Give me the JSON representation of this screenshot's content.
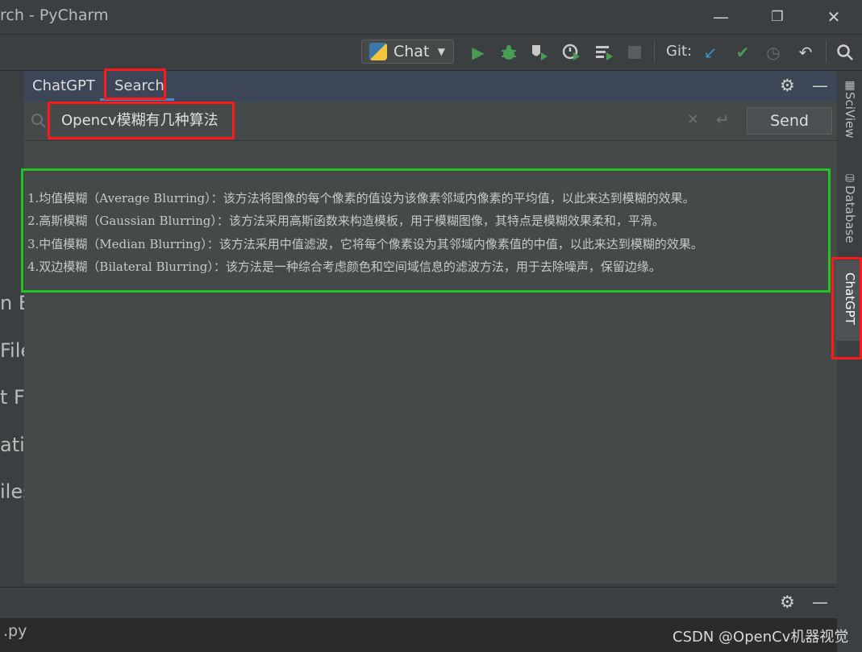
{
  "window": {
    "title": "rch - PyCharm"
  },
  "toolbar": {
    "run_config": "Chat",
    "git_label": "Git:"
  },
  "left_panel": {
    "fragments": [
      "n Ev",
      "File",
      "t Fi",
      "atio",
      "iles"
    ]
  },
  "tool_window": {
    "tabs": [
      "ChatGPT",
      "Search"
    ],
    "active_tab": "Search",
    "search_value": "Opencv模糊有几种算法",
    "send_label": "Send",
    "output_lines": [
      "1.均值模糊（Average Blurring）：该方法将图像的每个像素的值设为该像素邻域内像素的平均值，以此来达到模糊的效果。",
      "2.高斯模糊（Gaussian Blurring）：该方法采用高斯函数来构造模板，用于模糊图像，其特点是模糊效果柔和，平滑。",
      "3.中值模糊（Median Blurring）：该方法采用中值滤波，它将每个像素设为其邻域内像素值的中值，以此来达到模糊的效果。",
      "4.双边模糊（Bilateral Blurring）：该方法是一种综合考虑颜色和空间域信息的滤波方法，用于去除噪声，保留边缘。"
    ]
  },
  "right_strip": {
    "tabs": [
      "SciView",
      "Database",
      "ChatGPT"
    ]
  },
  "bottom": {
    "file": ".py"
  },
  "watermark": "CSDN @OpenCv机器视觉",
  "colors": {
    "accent": "#4a88c7",
    "run_green": "#499c54",
    "annotation_red": "#ff1a1a",
    "annotation_green": "#22c322"
  }
}
